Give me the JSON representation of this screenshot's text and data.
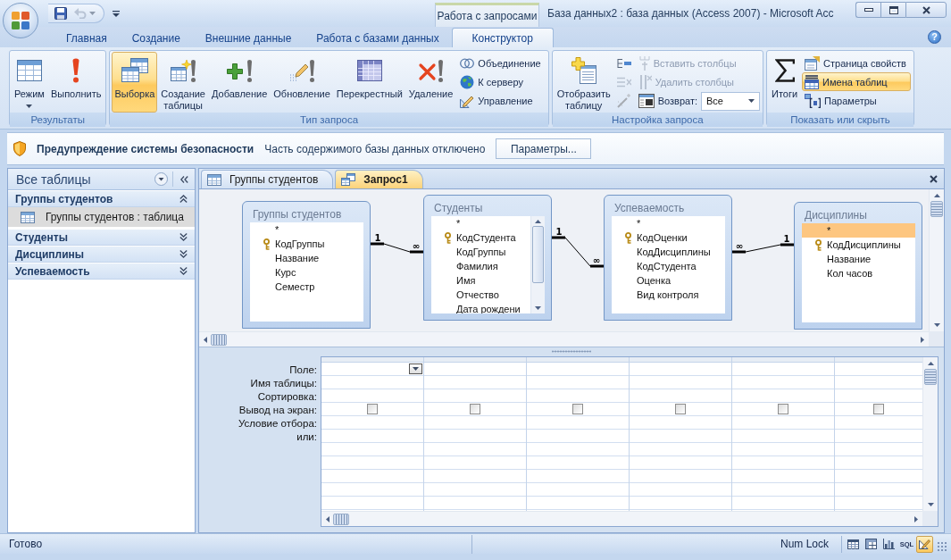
{
  "window": {
    "title": "База данных2 : база данных (Access 2007) - Microsoft Acc"
  },
  "quick_access": [
    {
      "kind": "save",
      "disabled": false
    },
    {
      "kind": "undo",
      "disabled": true
    }
  ],
  "contextual_tab_group": {
    "label": "Работа с запросами"
  },
  "ribbon_tabs": [
    {
      "label": "Главная",
      "selected": false
    },
    {
      "label": "Создание",
      "selected": false
    },
    {
      "label": "Внешние данные",
      "selected": false
    },
    {
      "label": "Работа с базами данных",
      "selected": false
    },
    {
      "label": "Конструктор",
      "selected": true
    }
  ],
  "help_button": "?",
  "ribbon_groups": [
    {
      "title": "Результаты",
      "items": [
        {
          "kind": "menu",
          "label": "Режим",
          "selected": false,
          "disabled": false
        },
        {
          "kind": "large",
          "label": "Выполнить",
          "selected": false,
          "disabled": false
        }
      ]
    },
    {
      "title": "Тип запроса",
      "items": [
        {
          "kind": "large",
          "label": "Выборка",
          "selected": true,
          "disabled": false
        },
        {
          "kind": "large",
          "label": "Создание таблицы",
          "selected": false,
          "disabled": false
        },
        {
          "kind": "large",
          "label": "Добавление",
          "selected": false,
          "disabled": false
        },
        {
          "kind": "large",
          "label": "Обновление",
          "selected": false,
          "disabled": false
        },
        {
          "kind": "large",
          "label": "Перекрестный",
          "selected": false,
          "disabled": false
        },
        {
          "kind": "large",
          "label": "Удаление",
          "selected": false,
          "disabled": false
        },
        {
          "kind": "small",
          "label": "Объединение",
          "selected": false,
          "disabled": false
        },
        {
          "kind": "small",
          "label": "К серверу",
          "selected": false,
          "disabled": false
        },
        {
          "kind": "small",
          "label": "Управление",
          "selected": false,
          "disabled": false
        }
      ]
    },
    {
      "title": "Настройка запроса",
      "items": [
        {
          "kind": "large",
          "label": "Отобразить таблицу",
          "selected": false,
          "disabled": false
        },
        {
          "kind": "icon",
          "selected": false,
          "disabled": false
        },
        {
          "kind": "icon",
          "selected": false,
          "disabled": true
        },
        {
          "kind": "icon",
          "selected": false,
          "disabled": true
        },
        {
          "kind": "small",
          "label": "Вставить столбцы",
          "selected": false,
          "disabled": true
        },
        {
          "kind": "small",
          "label": "Удалить столбцы",
          "selected": false,
          "disabled": true
        },
        {
          "kind": "combo",
          "label": "Возврат:",
          "value": "Все",
          "selected": false,
          "disabled": false
        }
      ]
    },
    {
      "title": "Показать или скрыть",
      "items": [
        {
          "kind": "large",
          "label": "Итоги",
          "selected": false,
          "disabled": false
        },
        {
          "kind": "small",
          "label": "Страница свойств",
          "selected": false,
          "disabled": false
        },
        {
          "kind": "small",
          "label": "Имена таблиц",
          "selected": true,
          "disabled": false
        },
        {
          "kind": "small",
          "label": "Параметры",
          "selected": false,
          "disabled": false
        }
      ]
    }
  ],
  "message_bar": {
    "title": "Предупреждение системы безопасности",
    "message": "Часть содержимого базы данных отключено",
    "button": "Параметры..."
  },
  "navigation_pane": {
    "header": "Все таблицы",
    "groups": [
      {
        "label": "Группы студентов",
        "expanded": true,
        "items": [
          {
            "label": "Группы студентов : таблица",
            "selected": true
          }
        ]
      },
      {
        "label": "Студенты",
        "expanded": false
      },
      {
        "label": "Дисциплины",
        "expanded": false
      },
      {
        "label": "Успеваемость",
        "expanded": false
      }
    ]
  },
  "document_tabs": [
    {
      "kind": "table",
      "label": "Группы студентов",
      "selected": false
    },
    {
      "kind": "query",
      "label": "Запрос1",
      "selected": true
    }
  ],
  "query_design": {
    "tables": [
      {
        "title": "Группы студентов",
        "scrollbar": false,
        "fields": [
          {
            "name": "*",
            "key": false,
            "selected": false
          },
          {
            "name": "КодГруппы",
            "key": true,
            "selected": false
          },
          {
            "name": "Название",
            "key": false,
            "selected": false
          },
          {
            "name": "Курс",
            "key": false,
            "selected": false
          },
          {
            "name": "Семестр",
            "key": false,
            "selected": false
          }
        ]
      },
      {
        "title": "Студенты",
        "scrollbar": true,
        "fields": [
          {
            "name": "*",
            "key": false,
            "selected": false
          },
          {
            "name": "КодСтудента",
            "key": true,
            "selected": false
          },
          {
            "name": "КодГруппы",
            "key": false,
            "selected": false
          },
          {
            "name": "Фамилия",
            "key": false,
            "selected": false
          },
          {
            "name": "Имя",
            "key": false,
            "selected": false
          },
          {
            "name": "Отчество",
            "key": false,
            "selected": false
          },
          {
            "name": "Дата рождени",
            "key": false,
            "selected": false
          }
        ]
      },
      {
        "title": "Успеваемость",
        "scrollbar": false,
        "fields": [
          {
            "name": "*",
            "key": false,
            "selected": false
          },
          {
            "name": "КодОценки",
            "key": true,
            "selected": false
          },
          {
            "name": "КодДисциплины",
            "key": false,
            "selected": false
          },
          {
            "name": "КодСтудента",
            "key": false,
            "selected": false
          },
          {
            "name": "Оценка",
            "key": false,
            "selected": false
          },
          {
            "name": "Вид контроля",
            "key": false,
            "selected": false
          }
        ]
      },
      {
        "title": "Дисциплины",
        "scrollbar": false,
        "fields": [
          {
            "name": "*",
            "key": false,
            "selected": true
          },
          {
            "name": "КодДисциплины",
            "key": true,
            "selected": false
          },
          {
            "name": "Название",
            "key": false,
            "selected": false
          },
          {
            "name": "Кол часов",
            "key": false,
            "selected": false
          }
        ]
      }
    ],
    "joins": [
      {
        "left_label": "1",
        "right_label": "∞"
      },
      {
        "left_label": "1",
        "right_label": "∞"
      },
      {
        "left_label": "∞",
        "right_label": "1"
      }
    ]
  },
  "query_grid": {
    "row_labels": [
      "Поле:",
      "Имя таблицы:",
      "Сортировка:",
      "Вывод на экран:",
      "Условие отбора:",
      "или:"
    ],
    "columns": [
      {
        "selected": true,
        "show": false
      },
      {
        "selected": false,
        "show": false
      },
      {
        "selected": false,
        "show": false
      },
      {
        "selected": false,
        "show": false
      },
      {
        "selected": false,
        "show": false
      },
      {
        "selected": false,
        "show": false
      }
    ]
  },
  "status_bar": {
    "text": "Готово",
    "indicator": "Num Lock",
    "views": [
      {
        "kind": "datasheet",
        "selected": false
      },
      {
        "kind": "pivot-table",
        "selected": false
      },
      {
        "kind": "pivot-chart",
        "selected": false
      },
      {
        "kind": "sql",
        "label": "SQL",
        "selected": false
      },
      {
        "kind": "design",
        "selected": true
      }
    ]
  }
}
